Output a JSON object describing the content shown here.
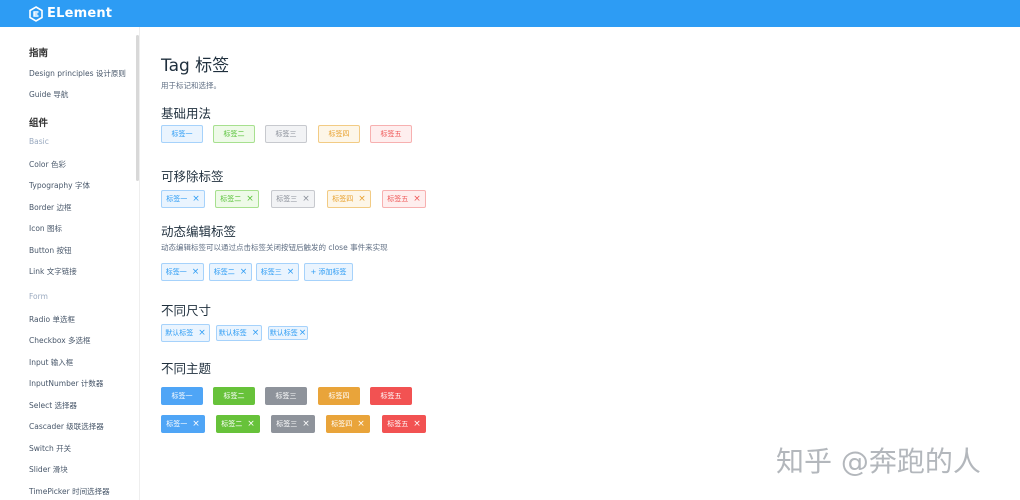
{
  "header": {
    "logo_text": "ELement"
  },
  "sidebar": {
    "guide_title": "指南",
    "guide_items": [
      "Design principles 设计原则",
      "Guide 导航"
    ],
    "components_title": "组件",
    "basic_group": "Basic",
    "basic_items": [
      "Color 色彩",
      "Typography 字体",
      "Border 边框",
      "Icon 图标",
      "Button 按钮",
      "Link 文字链接"
    ],
    "form_group": "Form",
    "form_items": [
      "Radio 单选框",
      "Checkbox 多选框",
      "Input 输入框",
      "InputNumber 计数器",
      "Select 选择器",
      "Cascader 级联选择器",
      "Switch 开关",
      "Slider 滑块",
      "TimePicker 时间选择器"
    ]
  },
  "main": {
    "title": "Tag 标签",
    "description": "用于标记和选择。",
    "basic": {
      "title": "基础用法",
      "tags": [
        "标签一",
        "标签二",
        "标签三",
        "标签四",
        "标签五"
      ]
    },
    "closable": {
      "title": "可移除标签",
      "tags": [
        "标签一",
        "标签二",
        "标签三",
        "标签四",
        "标签五"
      ]
    },
    "dynamic": {
      "title": "动态编辑标签",
      "description": "动态编辑标签可以通过点击标签关闭按钮后触发的 close 事件来实现",
      "tags": [
        "标签一",
        "标签二",
        "标签三"
      ],
      "add_label": "+ 添加标签"
    },
    "sizes": {
      "title": "不同尺寸",
      "tags": [
        "默认标签",
        "默认标签",
        "默认标签"
      ]
    },
    "themes": {
      "title": "不同主题",
      "row1": [
        "标签一",
        "标签二",
        "标签三",
        "标签四",
        "标签五"
      ],
      "row2": [
        "标签一",
        "标签二",
        "标签三",
        "标签四",
        "标签五"
      ]
    }
  },
  "close_glyph": "×",
  "watermark": "知乎 @奔跑的人",
  "colors": {
    "header": "#2d9cf4",
    "primary": "#409eff",
    "success": "#67c23a",
    "info": "#909399",
    "warning": "#e6a23c",
    "danger": "#f56c6c"
  }
}
